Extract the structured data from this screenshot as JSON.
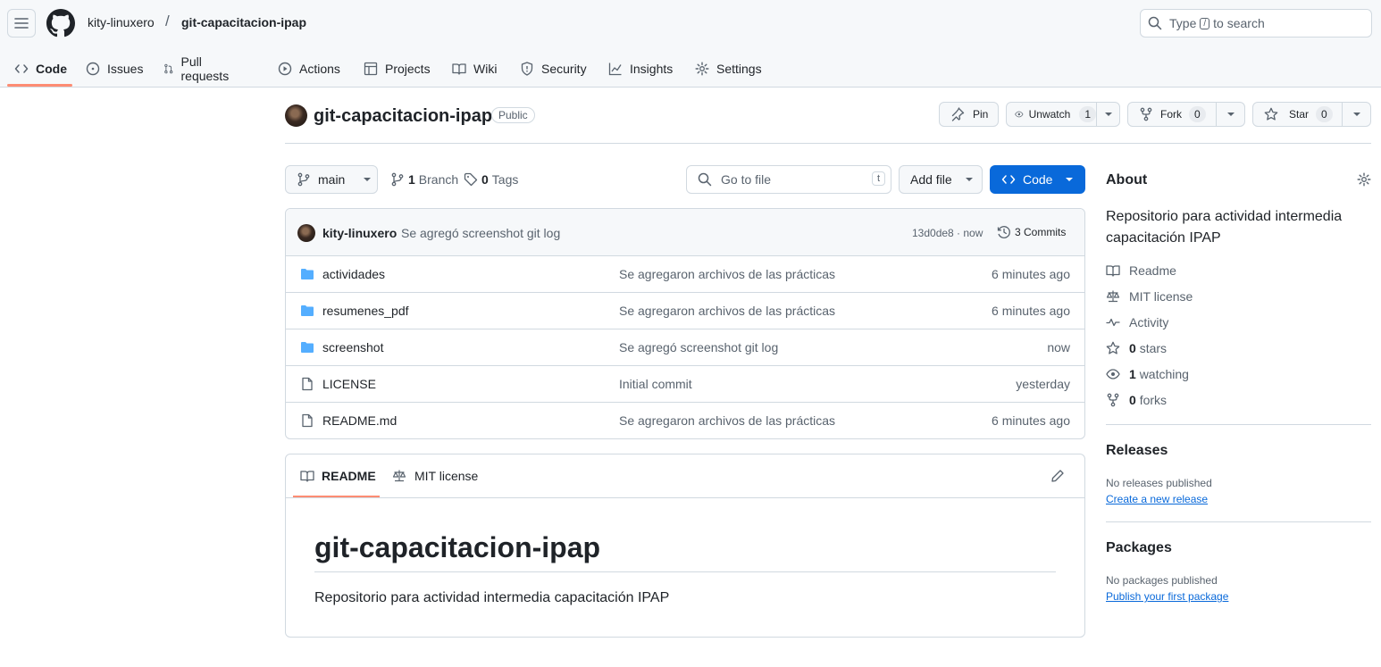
{
  "header": {
    "owner": "kity-linuxero",
    "separator": "/",
    "repo": "git-capacitacion-ipap",
    "search": {
      "prefix": "Type",
      "key": "/",
      "suffix": "to search"
    }
  },
  "nav": {
    "tabs": [
      {
        "label": "Code",
        "icon": "code-icon",
        "selected": true
      },
      {
        "label": "Issues",
        "icon": "issue-icon"
      },
      {
        "label": "Pull requests",
        "icon": "pull-request-icon"
      },
      {
        "label": "Actions",
        "icon": "play-icon"
      },
      {
        "label": "Projects",
        "icon": "table-icon"
      },
      {
        "label": "Wiki",
        "icon": "book-icon"
      },
      {
        "label": "Security",
        "icon": "shield-icon"
      },
      {
        "label": "Insights",
        "icon": "graph-icon"
      },
      {
        "label": "Settings",
        "icon": "gear-icon"
      }
    ]
  },
  "repo_header": {
    "name": "git-capacitacion-ipap",
    "visibility": "Public",
    "pin": "Pin",
    "unwatch": "Unwatch",
    "watch_count": "1",
    "fork": "Fork",
    "fork_count": "0",
    "star": "Star",
    "star_count": "0"
  },
  "toolbar": {
    "branch": "main",
    "branch_count": "1",
    "branch_label": "Branch",
    "tag_count": "0",
    "tag_label": "Tags",
    "goto_placeholder": "Go to file",
    "goto_key": "t",
    "add_file": "Add file",
    "code": "Code"
  },
  "commit": {
    "author": "kity-linuxero",
    "message": "Se agregó screenshot git log",
    "hash_time": "13d0de8 · now",
    "commits": "3 Commits"
  },
  "files": [
    {
      "name": "actividades",
      "type": "dir",
      "message": "Se agregaron archivos de las prácticas",
      "date": "6 minutes ago"
    },
    {
      "name": "resumenes_pdf",
      "type": "dir",
      "message": "Se agregaron archivos de las prácticas",
      "date": "6 minutes ago"
    },
    {
      "name": "screenshot",
      "type": "dir",
      "message": "Se agregó screenshot git log",
      "date": "now"
    },
    {
      "name": "LICENSE",
      "type": "file",
      "message": "Initial commit",
      "date": "yesterday"
    },
    {
      "name": "README.md",
      "type": "file",
      "message": "Se agregaron archivos de las prácticas",
      "date": "6 minutes ago"
    }
  ],
  "readme": {
    "tab_readme": "README",
    "tab_license": "MIT license",
    "title": "git-capacitacion-ipap",
    "body": "Repositorio para actividad intermedia capacitación IPAP"
  },
  "about": {
    "heading": "About",
    "description": "Repositorio para actividad intermedia capacitación IPAP",
    "links": {
      "readme": "Readme",
      "license": "MIT license",
      "activity": "Activity",
      "stars_count": "0",
      "stars_label": "stars",
      "watching_count": "1",
      "watching_label": "watching",
      "forks_count": "0",
      "forks_label": "forks"
    }
  },
  "releases": {
    "heading": "Releases",
    "empty": "No releases published",
    "link": "Create a new release"
  },
  "packages": {
    "heading": "Packages",
    "empty": "No packages published",
    "link": "Publish your first package"
  },
  "colors": {
    "accent_underline": "#fd8c73",
    "primary_button": "#0969da",
    "folder": "#54aeff",
    "link": "#0969da"
  }
}
